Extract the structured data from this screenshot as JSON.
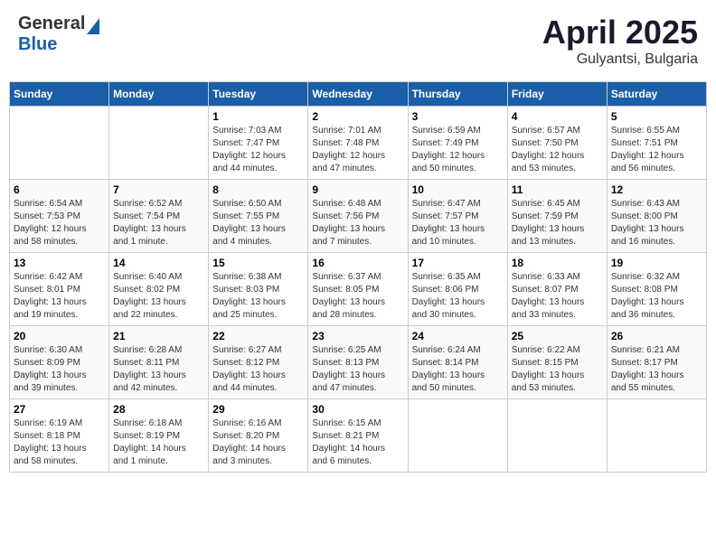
{
  "header": {
    "logo_general": "General",
    "logo_blue": "Blue",
    "month": "April 2025",
    "location": "Gulyantsi, Bulgaria"
  },
  "weekdays": [
    "Sunday",
    "Monday",
    "Tuesday",
    "Wednesday",
    "Thursday",
    "Friday",
    "Saturday"
  ],
  "weeks": [
    [
      {
        "day": "",
        "info": ""
      },
      {
        "day": "",
        "info": ""
      },
      {
        "day": "1",
        "info": "Sunrise: 7:03 AM\nSunset: 7:47 PM\nDaylight: 12 hours\nand 44 minutes."
      },
      {
        "day": "2",
        "info": "Sunrise: 7:01 AM\nSunset: 7:48 PM\nDaylight: 12 hours\nand 47 minutes."
      },
      {
        "day": "3",
        "info": "Sunrise: 6:59 AM\nSunset: 7:49 PM\nDaylight: 12 hours\nand 50 minutes."
      },
      {
        "day": "4",
        "info": "Sunrise: 6:57 AM\nSunset: 7:50 PM\nDaylight: 12 hours\nand 53 minutes."
      },
      {
        "day": "5",
        "info": "Sunrise: 6:55 AM\nSunset: 7:51 PM\nDaylight: 12 hours\nand 56 minutes."
      }
    ],
    [
      {
        "day": "6",
        "info": "Sunrise: 6:54 AM\nSunset: 7:53 PM\nDaylight: 12 hours\nand 58 minutes."
      },
      {
        "day": "7",
        "info": "Sunrise: 6:52 AM\nSunset: 7:54 PM\nDaylight: 13 hours\nand 1 minute."
      },
      {
        "day": "8",
        "info": "Sunrise: 6:50 AM\nSunset: 7:55 PM\nDaylight: 13 hours\nand 4 minutes."
      },
      {
        "day": "9",
        "info": "Sunrise: 6:48 AM\nSunset: 7:56 PM\nDaylight: 13 hours\nand 7 minutes."
      },
      {
        "day": "10",
        "info": "Sunrise: 6:47 AM\nSunset: 7:57 PM\nDaylight: 13 hours\nand 10 minutes."
      },
      {
        "day": "11",
        "info": "Sunrise: 6:45 AM\nSunset: 7:59 PM\nDaylight: 13 hours\nand 13 minutes."
      },
      {
        "day": "12",
        "info": "Sunrise: 6:43 AM\nSunset: 8:00 PM\nDaylight: 13 hours\nand 16 minutes."
      }
    ],
    [
      {
        "day": "13",
        "info": "Sunrise: 6:42 AM\nSunset: 8:01 PM\nDaylight: 13 hours\nand 19 minutes."
      },
      {
        "day": "14",
        "info": "Sunrise: 6:40 AM\nSunset: 8:02 PM\nDaylight: 13 hours\nand 22 minutes."
      },
      {
        "day": "15",
        "info": "Sunrise: 6:38 AM\nSunset: 8:03 PM\nDaylight: 13 hours\nand 25 minutes."
      },
      {
        "day": "16",
        "info": "Sunrise: 6:37 AM\nSunset: 8:05 PM\nDaylight: 13 hours\nand 28 minutes."
      },
      {
        "day": "17",
        "info": "Sunrise: 6:35 AM\nSunset: 8:06 PM\nDaylight: 13 hours\nand 30 minutes."
      },
      {
        "day": "18",
        "info": "Sunrise: 6:33 AM\nSunset: 8:07 PM\nDaylight: 13 hours\nand 33 minutes."
      },
      {
        "day": "19",
        "info": "Sunrise: 6:32 AM\nSunset: 8:08 PM\nDaylight: 13 hours\nand 36 minutes."
      }
    ],
    [
      {
        "day": "20",
        "info": "Sunrise: 6:30 AM\nSunset: 8:09 PM\nDaylight: 13 hours\nand 39 minutes."
      },
      {
        "day": "21",
        "info": "Sunrise: 6:28 AM\nSunset: 8:11 PM\nDaylight: 13 hours\nand 42 minutes."
      },
      {
        "day": "22",
        "info": "Sunrise: 6:27 AM\nSunset: 8:12 PM\nDaylight: 13 hours\nand 44 minutes."
      },
      {
        "day": "23",
        "info": "Sunrise: 6:25 AM\nSunset: 8:13 PM\nDaylight: 13 hours\nand 47 minutes."
      },
      {
        "day": "24",
        "info": "Sunrise: 6:24 AM\nSunset: 8:14 PM\nDaylight: 13 hours\nand 50 minutes."
      },
      {
        "day": "25",
        "info": "Sunrise: 6:22 AM\nSunset: 8:15 PM\nDaylight: 13 hours\nand 53 minutes."
      },
      {
        "day": "26",
        "info": "Sunrise: 6:21 AM\nSunset: 8:17 PM\nDaylight: 13 hours\nand 55 minutes."
      }
    ],
    [
      {
        "day": "27",
        "info": "Sunrise: 6:19 AM\nSunset: 8:18 PM\nDaylight: 13 hours\nand 58 minutes."
      },
      {
        "day": "28",
        "info": "Sunrise: 6:18 AM\nSunset: 8:19 PM\nDaylight: 14 hours\nand 1 minute."
      },
      {
        "day": "29",
        "info": "Sunrise: 6:16 AM\nSunset: 8:20 PM\nDaylight: 14 hours\nand 3 minutes."
      },
      {
        "day": "30",
        "info": "Sunrise: 6:15 AM\nSunset: 8:21 PM\nDaylight: 14 hours\nand 6 minutes."
      },
      {
        "day": "",
        "info": ""
      },
      {
        "day": "",
        "info": ""
      },
      {
        "day": "",
        "info": ""
      }
    ]
  ]
}
